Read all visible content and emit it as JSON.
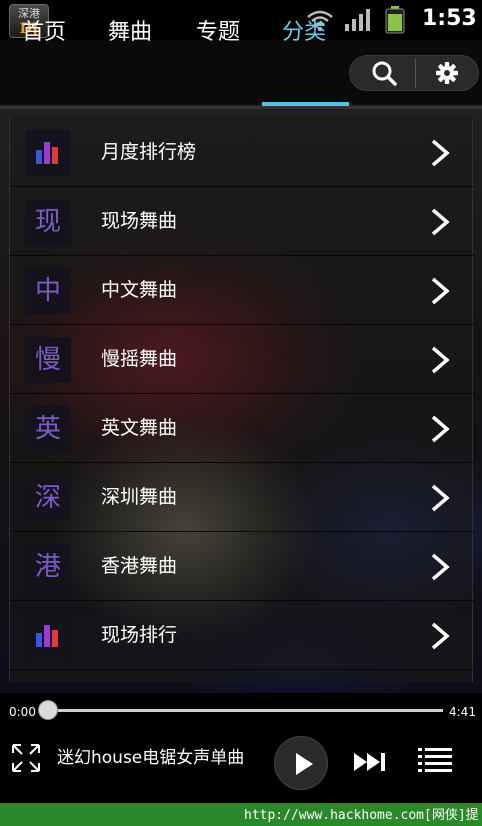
{
  "statusbar": {
    "app_icon_line1": "深港",
    "app_icon_line2": "DJ",
    "time": "1:53"
  },
  "tabs": [
    {
      "label": "首页",
      "active": false
    },
    {
      "label": "舞曲",
      "active": false
    },
    {
      "label": "专题",
      "active": false
    },
    {
      "label": "分类",
      "active": true
    }
  ],
  "actions": {
    "search_icon": "search-icon",
    "settings_icon": "gear-icon"
  },
  "categories": [
    {
      "label": "月度排行榜",
      "icon": "bar-chart-icon"
    },
    {
      "label": "现场舞曲",
      "icon_char": "现"
    },
    {
      "label": "中文舞曲",
      "icon_char": "中"
    },
    {
      "label": "慢摇舞曲",
      "icon_char": "慢"
    },
    {
      "label": "英文舞曲",
      "icon_char": "英"
    },
    {
      "label": "深圳舞曲",
      "icon_char": "深"
    },
    {
      "label": "香港舞曲",
      "icon_char": "港"
    },
    {
      "label": "现场排行",
      "icon": "bar-chart-icon"
    }
  ],
  "player": {
    "current_time": "0:00",
    "total_time": "4:41",
    "progress": 0,
    "song_title": "迷幻house电锯女声单曲"
  },
  "footer": {
    "text": "http://www.hackhome.com[网侠]提供"
  },
  "colors": {
    "accent": "#4fc3df",
    "icon_letter": "#7d5cc8",
    "footer_bg": "#2a8a2a"
  }
}
